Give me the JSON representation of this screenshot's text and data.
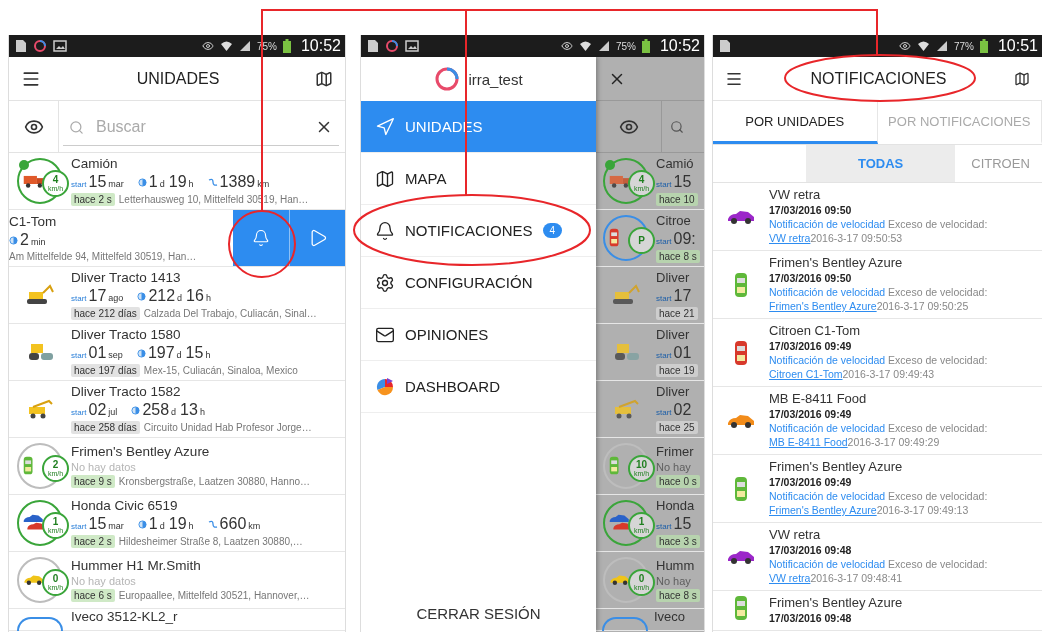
{
  "screens": [
    {
      "kind": "units",
      "status_bar": {
        "notifications": [
          {
            "kind": "file"
          },
          {
            "kind": "app"
          },
          {
            "kind": "image"
          }
        ],
        "battery": "75%",
        "time": "10:52"
      },
      "title": "UNIDADES",
      "search": {
        "placeholder": "Buscar"
      },
      "rows": [
        {
          "kind": "unit",
          "name": "Camión",
          "vehicle": {
            "kind": "truck"
          },
          "ring": {
            "color": "#3aa53a"
          },
          "tracked": true,
          "speed": "4",
          "speed_unit": "km/h",
          "start": {
            "label": "start",
            "day": "15",
            "month": "mar"
          },
          "duration": [
            {
              "value": "1",
              "unit": "d"
            },
            {
              "value": "19",
              "unit": "h"
            }
          ],
          "distance": {
            "value": "1389",
            "unit": "km"
          },
          "age": "hace 2 s",
          "fresh": true,
          "address": "Letterhausweg 10, Mittelfeld 30519, Han…"
        },
        {
          "kind": "swiped",
          "name": "C1-Tom",
          "duration": [
            {
              "value": "2",
              "unit": "min"
            }
          ],
          "address": "Am Mittelfelde 94, Mittelfeld 30519, Han…"
        },
        {
          "kind": "unit",
          "name": "Dliver Tracto 1413",
          "vehicle": {
            "kind": "excavator"
          },
          "start": {
            "label": "start",
            "day": "17",
            "month": "ago"
          },
          "duration": [
            {
              "value": "212",
              "unit": "d"
            },
            {
              "value": "16",
              "unit": "h"
            }
          ],
          "age": "hace 212 días",
          "fresh": false,
          "address": "Calzada Del Trabajo, Culiacán, Sinal…"
        },
        {
          "kind": "unit",
          "name": "Dliver Tracto 1580",
          "vehicle": {
            "kind": "roller"
          },
          "start": {
            "label": "start",
            "day": "01",
            "month": "sep"
          },
          "duration": [
            {
              "value": "197",
              "unit": "d"
            },
            {
              "value": "15",
              "unit": "h"
            }
          ],
          "age": "hace 197 días",
          "fresh": false,
          "address": "Mex-15, Culiacán, Sinaloa, Mexico"
        },
        {
          "kind": "unit",
          "name": "Dliver Tracto 1582",
          "vehicle": {
            "kind": "crane"
          },
          "start": {
            "label": "start",
            "day": "02",
            "month": "jul"
          },
          "duration": [
            {
              "value": "258",
              "unit": "d"
            },
            {
              "value": "13",
              "unit": "h"
            }
          ],
          "age": "hace 258 días",
          "fresh": false,
          "address": "Circuito Unidad Hab Profesor Jorge…"
        },
        {
          "kind": "unit",
          "name": "Frimen's Bentley Azure",
          "vehicle": {
            "kind": "car-top",
            "color": "#5fb83a"
          },
          "ring": {
            "color": "#bdbdbd"
          },
          "tracked": false,
          "speed": "2",
          "speed_unit": "km/h",
          "no_data": "No hay datos",
          "age": "hace 9 s",
          "fresh": true,
          "address": "Kronsbergstraße, Laatzen 30880, Hanno…"
        },
        {
          "kind": "unit",
          "name": "Honda Civic 6519",
          "vehicle": {
            "kind": "car-pair",
            "color": "#2a62c9"
          },
          "ring": {
            "color": "#3aa53a"
          },
          "tracked": false,
          "speed": "1",
          "speed_unit": "km/h",
          "start": {
            "label": "start",
            "day": "15",
            "month": "mar"
          },
          "duration": [
            {
              "value": "1",
              "unit": "d"
            },
            {
              "value": "19",
              "unit": "h"
            }
          ],
          "distance": {
            "value": "660",
            "unit": "km"
          },
          "age": "hace 2 s",
          "fresh": true,
          "address": "Hildesheimer Straße 8, Laatzen 30880,…"
        },
        {
          "kind": "unit",
          "name": "Hummer H1 Mr.Smith",
          "vehicle": {
            "kind": "car-side",
            "color": "#f0c419"
          },
          "ring": {
            "color": "#bdbdbd"
          },
          "tracked": false,
          "speed": "0",
          "speed_unit": "km/h",
          "no_data": "No hay datos",
          "age": "hace 6 s",
          "fresh": true,
          "address": "Europaallee, Mittelfeld 30521, Hannover,…"
        },
        {
          "kind": "partial",
          "name": "Iveco 3512-KL2_r",
          "ring": {
            "color": "#3a8ee6"
          }
        }
      ]
    },
    {
      "kind": "drawer",
      "status_bar": {
        "notifications": [
          {
            "kind": "file"
          },
          {
            "kind": "app"
          },
          {
            "kind": "image"
          }
        ],
        "battery": "75%",
        "time": "10:52"
      },
      "account": "irra_test",
      "menu": [
        {
          "label": "UNIDADES",
          "selected": true
        },
        {
          "label": "MAPA",
          "selected": false
        },
        {
          "label": "NOTIFICACIONES",
          "selected": false,
          "badge": "4"
        },
        {
          "label": "CONFIGURACIÓN",
          "selected": false
        },
        {
          "label": "OPINIONES",
          "selected": false
        },
        {
          "label": "DASHBOARD",
          "selected": false
        }
      ],
      "logout": "CERRAR SESIÓN",
      "behind": [
        {
          "kind": "unit",
          "name": "Camió",
          "vehicle": {
            "kind": "truck"
          },
          "ring": {
            "color": "#3aa53a"
          },
          "tracked": true,
          "speed": "4",
          "speed_unit": "km/h",
          "stat": {
            "label": "start",
            "value": "15"
          },
          "age": "hace 10",
          "fresh": true
        },
        {
          "kind": "unit",
          "name": "Citroe",
          "vehicle": {
            "kind": "car-top",
            "color": "#d8392b"
          },
          "ring": {
            "color": "#3a8ee6"
          },
          "tracked": false,
          "speed": "P",
          "stat": {
            "label": "start",
            "value": "09:"
          },
          "age": "hace 8 s",
          "fresh": true
        },
        {
          "kind": "unit",
          "name": "Dliver",
          "vehicle": {
            "kind": "excavator"
          },
          "stat": {
            "label": "start",
            "value": "17"
          },
          "age": "hace 21",
          "fresh": false
        },
        {
          "kind": "unit",
          "name": "Dliver",
          "vehicle": {
            "kind": "roller"
          },
          "stat": {
            "label": "start",
            "value": "01"
          },
          "age": "hace 19",
          "fresh": false
        },
        {
          "kind": "unit",
          "name": "Dliver",
          "vehicle": {
            "kind": "crane"
          },
          "stat": {
            "label": "start",
            "value": "02"
          },
          "age": "hace 25",
          "fresh": false
        },
        {
          "kind": "unit",
          "name": "Frimer",
          "vehicle": {
            "kind": "car-top",
            "color": "#5fb83a"
          },
          "ring": {
            "color": "#bdbdbd"
          },
          "tracked": false,
          "speed": "10",
          "speed_unit": "km/h",
          "no_data": "No hay",
          "age": "hace 0 s",
          "fresh": true
        },
        {
          "kind": "unit",
          "name": "Honda",
          "vehicle": {
            "kind": "car-pair",
            "color": "#2a62c9"
          },
          "ring": {
            "color": "#3aa53a"
          },
          "tracked": false,
          "speed": "1",
          "speed_unit": "km/h",
          "stat": {
            "label": "start",
            "value": "15"
          },
          "age": "hace 3 s",
          "fresh": true
        },
        {
          "kind": "unit",
          "name": "Humm",
          "vehicle": {
            "kind": "car-side",
            "color": "#f0c419"
          },
          "ring": {
            "color": "#bdbdbd"
          },
          "tracked": false,
          "speed": "0",
          "speed_unit": "km/h",
          "no_data": "No hay",
          "age": "hace 8 s",
          "fresh": true
        },
        {
          "kind": "partial",
          "name": "Iveco",
          "ring": {
            "color": "#3a8ee6"
          }
        }
      ]
    },
    {
      "kind": "notifications",
      "status_bar": {
        "notifications": [
          {
            "kind": "file"
          }
        ],
        "battery": "77%",
        "time": "10:51"
      },
      "title": "NOTIFICACIONES",
      "tabs": [
        {
          "label": "POR UNIDADES",
          "selected": true
        },
        {
          "label": "POR NOTIFICACIONES",
          "selected": false
        }
      ],
      "filters": [
        {
          "label": "TODAS",
          "selected": true
        },
        {
          "label": "CITROEN",
          "selected": false
        }
      ],
      "items": [
        {
          "unit": "VW retra",
          "vehicle": {
            "kind": "car-side",
            "color": "#9b27c9"
          },
          "date": "17/03/2016 09:50",
          "type": "Notificación de velocidad",
          "text": "Exceso de velocidad:",
          "link": "VW retra",
          "stamp": "2016-3-17 09:50:53"
        },
        {
          "unit": "Frimen's Bentley Azure",
          "vehicle": {
            "kind": "car-top",
            "color": "#5fb83a"
          },
          "date": "17/03/2016 09:50",
          "type": "Notificación de velocidad",
          "text": "Exceso de velocidad:",
          "link": "Frimen's Bentley Azure",
          "stamp": "2016-3-17 09:50:25"
        },
        {
          "unit": "Citroen C1-Tom",
          "vehicle": {
            "kind": "car-top",
            "color": "#d8392b"
          },
          "date": "17/03/2016 09:49",
          "type": "Notificación de velocidad",
          "text": "Exceso de velocidad:",
          "link": "Citroen C1-Tom",
          "stamp": "2016-3-17 09:49:43"
        },
        {
          "unit": "MB E-8411 Food",
          "vehicle": {
            "kind": "car-side",
            "color": "#f28c1a"
          },
          "date": "17/03/2016 09:49",
          "type": "Notificación de velocidad",
          "text": "Exceso de velocidad:",
          "link": "MB E-8411 Food",
          "stamp": "2016-3-17 09:49:29"
        },
        {
          "unit": "Frimen's Bentley Azure",
          "vehicle": {
            "kind": "car-top",
            "color": "#5fb83a"
          },
          "date": "17/03/2016 09:49",
          "type": "Notificación de velocidad",
          "text": "Exceso de velocidad:",
          "link": "Frimen's Bentley Azure",
          "stamp": "2016-3-17 09:49:13"
        },
        {
          "unit": "VW retra",
          "vehicle": {
            "kind": "car-side",
            "color": "#9b27c9"
          },
          "date": "17/03/2016 09:48",
          "type": "Notificación de velocidad",
          "text": "Exceso de velocidad:",
          "link": "VW retra",
          "stamp": "2016-3-17 09:48:41"
        },
        {
          "unit": "Frimen's Bentley Azure",
          "vehicle": {
            "kind": "car-top",
            "color": "#5fb83a"
          },
          "date": "17/03/2016 09:48"
        }
      ]
    }
  ]
}
